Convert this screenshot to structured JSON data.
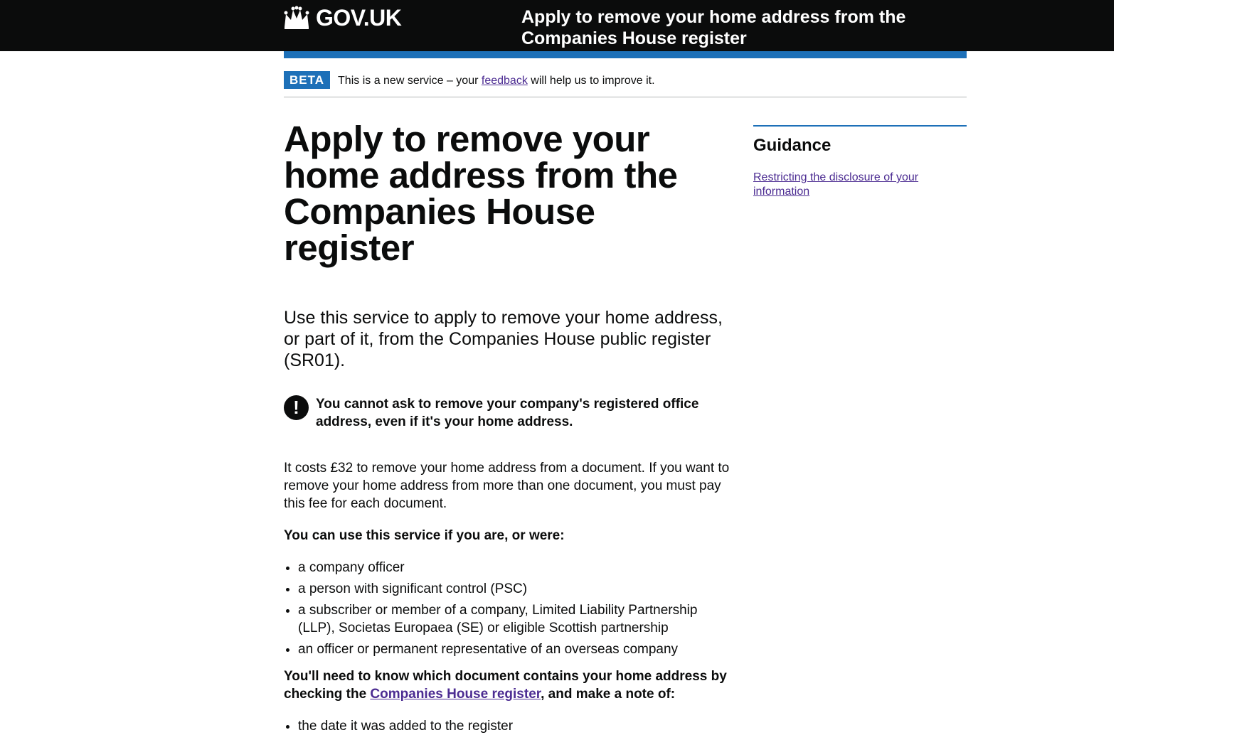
{
  "header": {
    "logo_text": "GOV.UK",
    "service_name": "Apply to remove your home address from the Companies House register"
  },
  "phase_banner": {
    "tag": "BETA",
    "text_before": "This is a new service – your ",
    "link": "feedback",
    "text_after": " will help us to improve it."
  },
  "main": {
    "title": "Apply to remove your home address from the Companies House register",
    "lead": "Use this service to apply to remove your home address, or part of it, from the Companies House public register (SR01).",
    "warning_icon": "!",
    "warning": "You cannot ask to remove your company's registered office address, even if it's your home address.",
    "cost": "It costs £32 to remove your home address from a document. If you want to remove your home address from more than one document, you must pay this fee for each document.",
    "eligibility_heading": "You can use this service if you are, or were:",
    "eligibility_items": [
      "a company officer",
      "a person with significant control (PSC)",
      "a subscriber or member of a company, Limited Liability Partnership (LLP), Societas Europaea (SE) or eligible Scottish partnership",
      "an officer or permanent representative of an overseas company"
    ],
    "need_before": "You'll need to know which document contains your home address by checking the ",
    "need_link": "Companies House register",
    "need_after": ", and make a note of:",
    "note_items": [
      "the date it was added to the register"
    ]
  },
  "aside": {
    "heading": "Guidance",
    "link": "Restricting the disclosure of your information"
  },
  "colors": {
    "header_bg": "#0b0c0c",
    "brand_blue": "#1d70b8",
    "link_visited": "#4c2c92"
  },
  "icons": [
    "crown-icon",
    "warning-icon"
  ]
}
